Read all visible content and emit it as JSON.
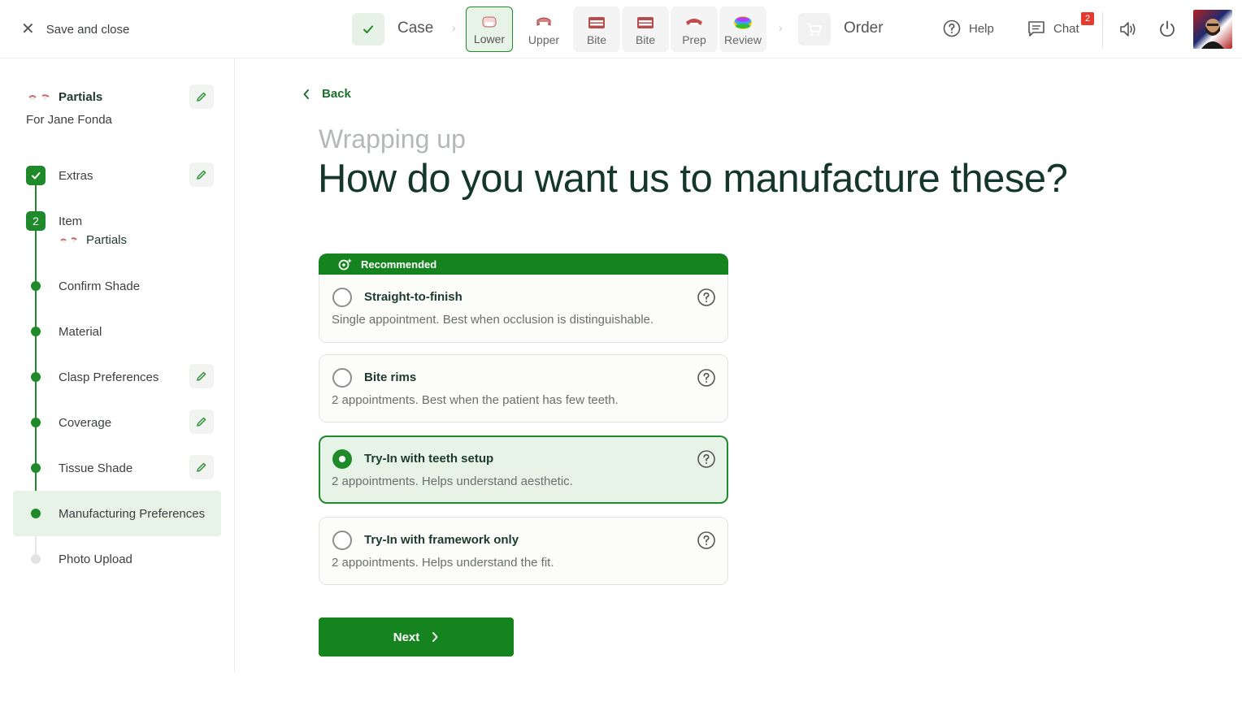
{
  "topbar": {
    "save_close": "Save and close",
    "steps": {
      "case": "Case",
      "lower": "Lower",
      "upper": "Upper",
      "bite1": "Bite",
      "bite2": "Bite",
      "prep": "Prep",
      "review": "Review",
      "order": "Order"
    },
    "help": "Help",
    "chat": "Chat",
    "chat_badge": "2"
  },
  "sidebar": {
    "title": "Partials",
    "subtitle": "For Jane Fonda",
    "steps": {
      "extras": "Extras",
      "item_number": "2",
      "item": "Item",
      "item_sub": "Partials",
      "confirm_shade": "Confirm Shade",
      "material": "Material",
      "clasp": "Clasp Preferences",
      "coverage": "Coverage",
      "tissue": "Tissue Shade",
      "manufacturing": "Manufacturing Preferences",
      "photo": "Photo Upload"
    }
  },
  "main": {
    "back": "Back",
    "kicker": "Wrapping up",
    "headline": "How do you want us to manufacture these?",
    "recommended": "Recommended",
    "options": [
      {
        "title": "Straight-to-finish",
        "desc": "Single appointment. Best when occlusion is distinguishable."
      },
      {
        "title": "Bite rims",
        "desc": "2 appointments. Best when the patient has few teeth."
      },
      {
        "title": "Try-In with teeth setup",
        "desc": "2 appointments. Helps understand aesthetic."
      },
      {
        "title": "Try-In with framework only",
        "desc": "2 appointments. Helps understand the fit."
      }
    ],
    "selected_option": "Try-In with teeth setup",
    "next": "Next"
  },
  "colors": {
    "accent": "#15841f",
    "accent_light": "#e8f3e8",
    "headline": "#14362c",
    "badge": "#e53b2f"
  }
}
